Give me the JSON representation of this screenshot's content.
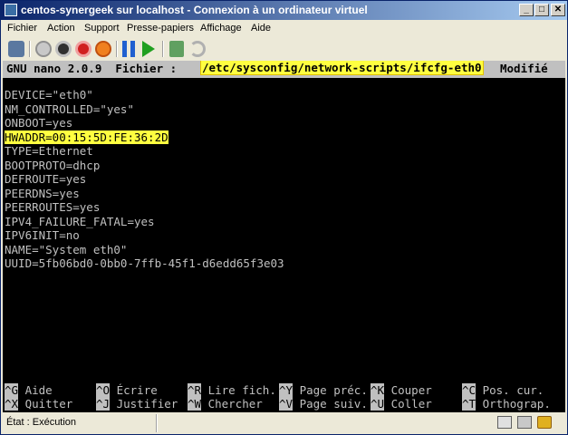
{
  "window": {
    "title": "centos-synergeek sur localhost - Connexion à un ordinateur virtuel",
    "min": "_",
    "max": "□",
    "close": "✕"
  },
  "menu": [
    "Fichier",
    "Action",
    "Support",
    "Presse-papiers",
    "Affichage",
    "Aide"
  ],
  "nano": {
    "app": "GNU nano 2.0.9",
    "file_label": "Fichier :",
    "path": "/etc/sysconfig/network-scripts/ifcfg-eth0",
    "modified": "Modifié"
  },
  "file_lines": [
    "DEVICE=\"eth0\"",
    "NM_CONTROLLED=\"yes\"",
    "ONBOOT=yes",
    "HWADDR=00:15:5D:FE:36:2D",
    "TYPE=Ethernet",
    "BOOTPROTO=dhcp",
    "DEFROUTE=yes",
    "PEERDNS=yes",
    "PEERROUTES=yes",
    "IPV4_FAILURE_FATAL=yes",
    "IPV6INIT=no",
    "NAME=\"System eth0\"",
    "UUID=5fb06bd0-0bb0-7ffb-45f1-d6edd65f3e03"
  ],
  "shortcuts_row1": [
    {
      "key": "^G",
      "label": " Aide"
    },
    {
      "key": "^O",
      "label": " Écrire"
    },
    {
      "key": "^R",
      "label": " Lire fich."
    },
    {
      "key": "^Y",
      "label": " Page préc."
    },
    {
      "key": "^K",
      "label": " Couper"
    },
    {
      "key": "^C",
      "label": " Pos. cur."
    }
  ],
  "shortcuts_row2": [
    {
      "key": "^X",
      "label": " Quitter"
    },
    {
      "key": "^J",
      "label": " Justifier"
    },
    {
      "key": "^W",
      "label": " Chercher"
    },
    {
      "key": "^V",
      "label": " Page suiv."
    },
    {
      "key": "^U",
      "label": " Coller"
    },
    {
      "key": "^T",
      "label": " Orthograp."
    }
  ],
  "status": {
    "text": "État : Exécution"
  },
  "colors": {
    "title_start": "#0a246a",
    "title_end": "#a6caf0",
    "highlight": "#ffff40",
    "terminal_bg": "#000000",
    "terminal_fg": "#c0c0c0"
  },
  "toolbar_icons": [
    "ctrl-alt-del-icon",
    "start-icon",
    "turn-off-icon",
    "shutdown-icon",
    "power-icon",
    "pause-icon",
    "resume-icon",
    "snapshot-icon",
    "revert-icon"
  ]
}
